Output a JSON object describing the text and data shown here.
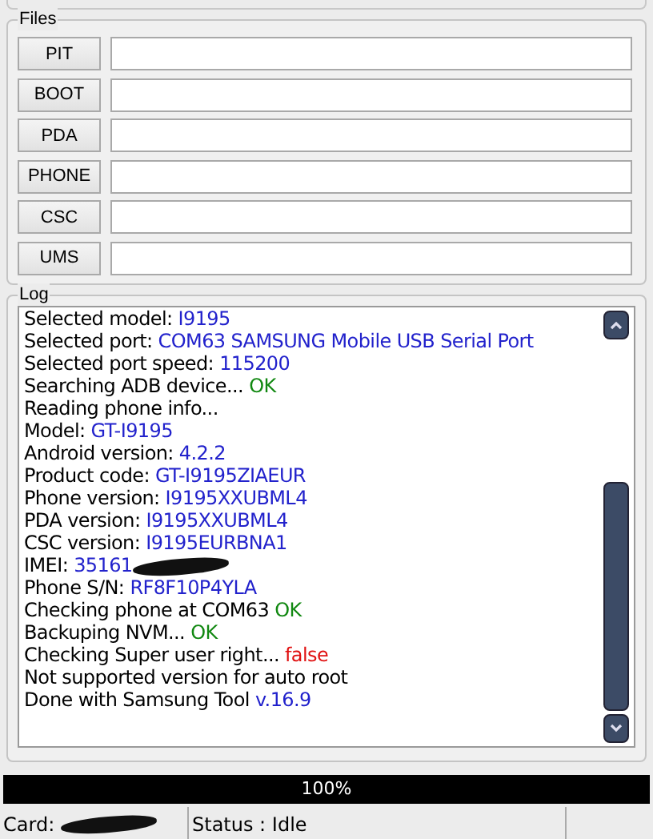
{
  "files": {
    "title": "Files",
    "rows": [
      {
        "button": "PIT"
      },
      {
        "button": "BOOT"
      },
      {
        "button": "PDA"
      },
      {
        "button": "PHONE"
      },
      {
        "button": "CSC"
      },
      {
        "button": "UMS"
      }
    ]
  },
  "log": {
    "title": "Log",
    "lines": [
      {
        "text": "Selected model: ",
        "value": "I9195",
        "kind": "info"
      },
      {
        "text": "Selected port: ",
        "value": "COM63 SAMSUNG Mobile USB Serial Port",
        "kind": "info"
      },
      {
        "text": "Selected port speed: ",
        "value": "115200",
        "kind": "info"
      },
      {
        "text": "Searching ADB device... ",
        "value": "OK",
        "kind": "ok"
      },
      {
        "text": "Reading phone info..."
      },
      {
        "text": "Model: ",
        "value": "GT-I9195",
        "kind": "info"
      },
      {
        "text": "Android version: ",
        "value": "4.2.2",
        "kind": "info"
      },
      {
        "text": "Product code: ",
        "value": "GT-I9195ZIAEUR",
        "kind": "info"
      },
      {
        "text": "Phone version: ",
        "value": "I9195XXUBML4",
        "kind": "info"
      },
      {
        "text": "PDA version: ",
        "value": "I9195XXUBML4",
        "kind": "info"
      },
      {
        "text": "CSC version: ",
        "value": "I9195EURBNA1",
        "kind": "info"
      },
      {
        "text": "IMEI: ",
        "value": "35161",
        "kind": "info",
        "redacted": true
      },
      {
        "text": "Phone S/N: ",
        "value": "RF8F10P4YLA",
        "kind": "info"
      },
      {
        "text": "Checking phone at COM63 ",
        "value": "OK",
        "kind": "ok"
      },
      {
        "text": "Backuping NVM... ",
        "value": "OK",
        "kind": "ok"
      },
      {
        "text": "Checking Super user right... ",
        "value": "false",
        "kind": "error"
      },
      {
        "text": "Not supported version for auto root"
      },
      {
        "text": "Done with Samsung Tool ",
        "value": "v.16.9",
        "kind": "info"
      }
    ]
  },
  "progress": {
    "level": 1,
    "label": "100%"
  },
  "status_bar": [
    {
      "text": "Card:",
      "redacted": true
    },
    {
      "text": "Status : Idle"
    }
  ]
}
